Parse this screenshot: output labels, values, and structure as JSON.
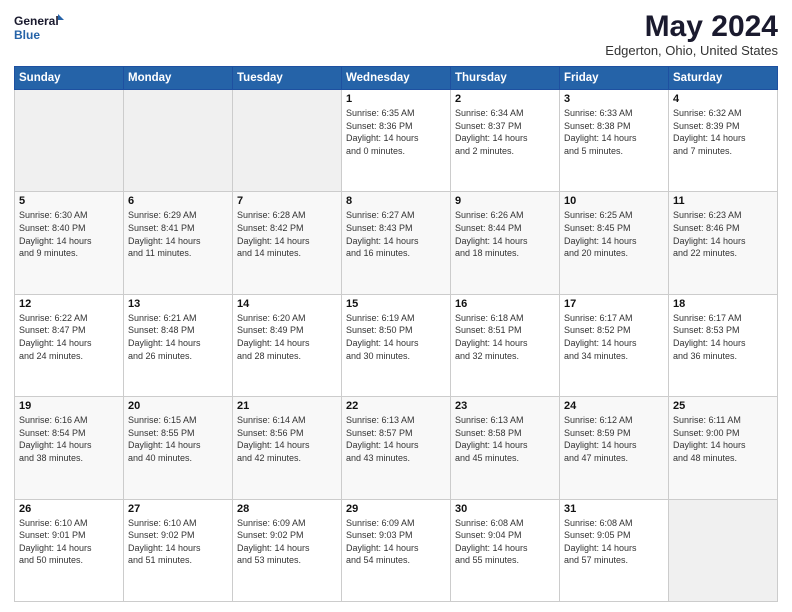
{
  "logo": {
    "line1": "General",
    "line2": "Blue"
  },
  "title": "May 2024",
  "subtitle": "Edgerton, Ohio, United States",
  "days_of_week": [
    "Sunday",
    "Monday",
    "Tuesday",
    "Wednesday",
    "Thursday",
    "Friday",
    "Saturday"
  ],
  "weeks": [
    [
      {
        "day": "",
        "info": ""
      },
      {
        "day": "",
        "info": ""
      },
      {
        "day": "",
        "info": ""
      },
      {
        "day": "1",
        "info": "Sunrise: 6:35 AM\nSunset: 8:36 PM\nDaylight: 14 hours\nand 0 minutes."
      },
      {
        "day": "2",
        "info": "Sunrise: 6:34 AM\nSunset: 8:37 PM\nDaylight: 14 hours\nand 2 minutes."
      },
      {
        "day": "3",
        "info": "Sunrise: 6:33 AM\nSunset: 8:38 PM\nDaylight: 14 hours\nand 5 minutes."
      },
      {
        "day": "4",
        "info": "Sunrise: 6:32 AM\nSunset: 8:39 PM\nDaylight: 14 hours\nand 7 minutes."
      }
    ],
    [
      {
        "day": "5",
        "info": "Sunrise: 6:30 AM\nSunset: 8:40 PM\nDaylight: 14 hours\nand 9 minutes."
      },
      {
        "day": "6",
        "info": "Sunrise: 6:29 AM\nSunset: 8:41 PM\nDaylight: 14 hours\nand 11 minutes."
      },
      {
        "day": "7",
        "info": "Sunrise: 6:28 AM\nSunset: 8:42 PM\nDaylight: 14 hours\nand 14 minutes."
      },
      {
        "day": "8",
        "info": "Sunrise: 6:27 AM\nSunset: 8:43 PM\nDaylight: 14 hours\nand 16 minutes."
      },
      {
        "day": "9",
        "info": "Sunrise: 6:26 AM\nSunset: 8:44 PM\nDaylight: 14 hours\nand 18 minutes."
      },
      {
        "day": "10",
        "info": "Sunrise: 6:25 AM\nSunset: 8:45 PM\nDaylight: 14 hours\nand 20 minutes."
      },
      {
        "day": "11",
        "info": "Sunrise: 6:23 AM\nSunset: 8:46 PM\nDaylight: 14 hours\nand 22 minutes."
      }
    ],
    [
      {
        "day": "12",
        "info": "Sunrise: 6:22 AM\nSunset: 8:47 PM\nDaylight: 14 hours\nand 24 minutes."
      },
      {
        "day": "13",
        "info": "Sunrise: 6:21 AM\nSunset: 8:48 PM\nDaylight: 14 hours\nand 26 minutes."
      },
      {
        "day": "14",
        "info": "Sunrise: 6:20 AM\nSunset: 8:49 PM\nDaylight: 14 hours\nand 28 minutes."
      },
      {
        "day": "15",
        "info": "Sunrise: 6:19 AM\nSunset: 8:50 PM\nDaylight: 14 hours\nand 30 minutes."
      },
      {
        "day": "16",
        "info": "Sunrise: 6:18 AM\nSunset: 8:51 PM\nDaylight: 14 hours\nand 32 minutes."
      },
      {
        "day": "17",
        "info": "Sunrise: 6:17 AM\nSunset: 8:52 PM\nDaylight: 14 hours\nand 34 minutes."
      },
      {
        "day": "18",
        "info": "Sunrise: 6:17 AM\nSunset: 8:53 PM\nDaylight: 14 hours\nand 36 minutes."
      }
    ],
    [
      {
        "day": "19",
        "info": "Sunrise: 6:16 AM\nSunset: 8:54 PM\nDaylight: 14 hours\nand 38 minutes."
      },
      {
        "day": "20",
        "info": "Sunrise: 6:15 AM\nSunset: 8:55 PM\nDaylight: 14 hours\nand 40 minutes."
      },
      {
        "day": "21",
        "info": "Sunrise: 6:14 AM\nSunset: 8:56 PM\nDaylight: 14 hours\nand 42 minutes."
      },
      {
        "day": "22",
        "info": "Sunrise: 6:13 AM\nSunset: 8:57 PM\nDaylight: 14 hours\nand 43 minutes."
      },
      {
        "day": "23",
        "info": "Sunrise: 6:13 AM\nSunset: 8:58 PM\nDaylight: 14 hours\nand 45 minutes."
      },
      {
        "day": "24",
        "info": "Sunrise: 6:12 AM\nSunset: 8:59 PM\nDaylight: 14 hours\nand 47 minutes."
      },
      {
        "day": "25",
        "info": "Sunrise: 6:11 AM\nSunset: 9:00 PM\nDaylight: 14 hours\nand 48 minutes."
      }
    ],
    [
      {
        "day": "26",
        "info": "Sunrise: 6:10 AM\nSunset: 9:01 PM\nDaylight: 14 hours\nand 50 minutes."
      },
      {
        "day": "27",
        "info": "Sunrise: 6:10 AM\nSunset: 9:02 PM\nDaylight: 14 hours\nand 51 minutes."
      },
      {
        "day": "28",
        "info": "Sunrise: 6:09 AM\nSunset: 9:02 PM\nDaylight: 14 hours\nand 53 minutes."
      },
      {
        "day": "29",
        "info": "Sunrise: 6:09 AM\nSunset: 9:03 PM\nDaylight: 14 hours\nand 54 minutes."
      },
      {
        "day": "30",
        "info": "Sunrise: 6:08 AM\nSunset: 9:04 PM\nDaylight: 14 hours\nand 55 minutes."
      },
      {
        "day": "31",
        "info": "Sunrise: 6:08 AM\nSunset: 9:05 PM\nDaylight: 14 hours\nand 57 minutes."
      },
      {
        "day": "",
        "info": ""
      }
    ]
  ]
}
